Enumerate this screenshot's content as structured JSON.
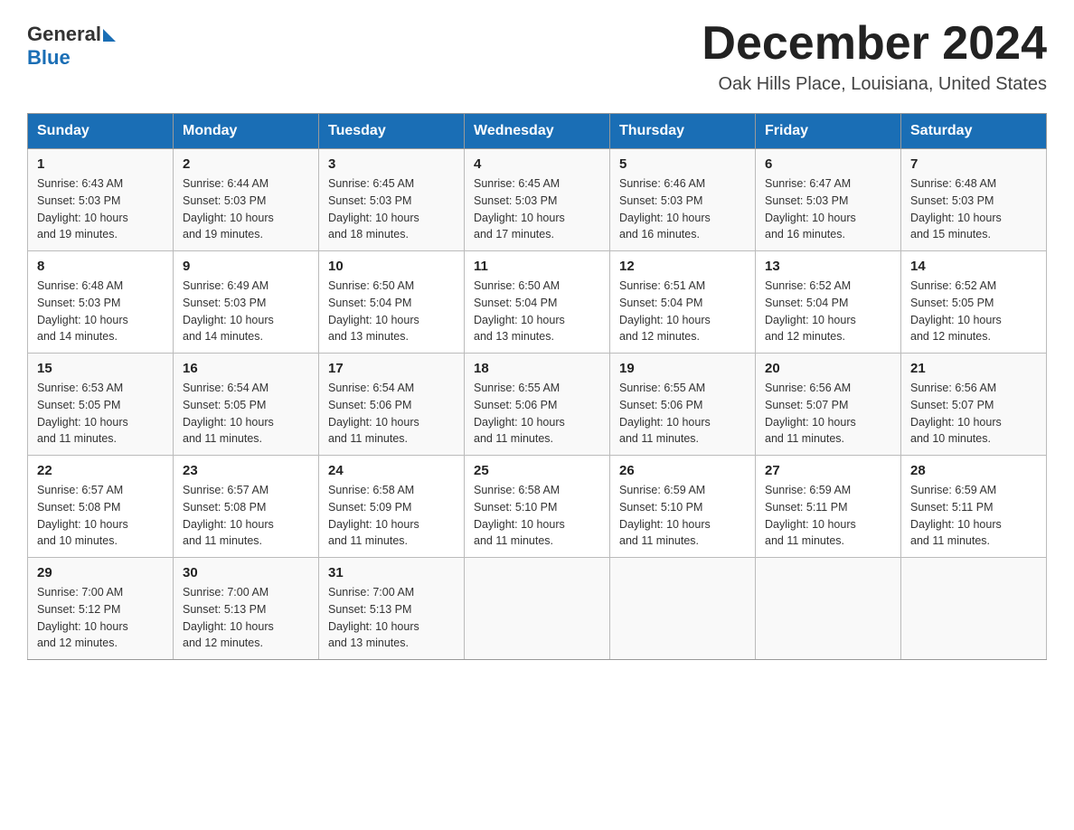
{
  "header": {
    "logo_general": "General",
    "logo_blue": "Blue",
    "month_title": "December 2024",
    "location": "Oak Hills Place, Louisiana, United States"
  },
  "days_of_week": [
    "Sunday",
    "Monday",
    "Tuesday",
    "Wednesday",
    "Thursday",
    "Friday",
    "Saturday"
  ],
  "weeks": [
    [
      {
        "day": "1",
        "sunrise": "6:43 AM",
        "sunset": "5:03 PM",
        "daylight": "10 hours and 19 minutes."
      },
      {
        "day": "2",
        "sunrise": "6:44 AM",
        "sunset": "5:03 PM",
        "daylight": "10 hours and 19 minutes."
      },
      {
        "day": "3",
        "sunrise": "6:45 AM",
        "sunset": "5:03 PM",
        "daylight": "10 hours and 18 minutes."
      },
      {
        "day": "4",
        "sunrise": "6:45 AM",
        "sunset": "5:03 PM",
        "daylight": "10 hours and 17 minutes."
      },
      {
        "day": "5",
        "sunrise": "6:46 AM",
        "sunset": "5:03 PM",
        "daylight": "10 hours and 16 minutes."
      },
      {
        "day": "6",
        "sunrise": "6:47 AM",
        "sunset": "5:03 PM",
        "daylight": "10 hours and 16 minutes."
      },
      {
        "day": "7",
        "sunrise": "6:48 AM",
        "sunset": "5:03 PM",
        "daylight": "10 hours and 15 minutes."
      }
    ],
    [
      {
        "day": "8",
        "sunrise": "6:48 AM",
        "sunset": "5:03 PM",
        "daylight": "10 hours and 14 minutes."
      },
      {
        "day": "9",
        "sunrise": "6:49 AM",
        "sunset": "5:03 PM",
        "daylight": "10 hours and 14 minutes."
      },
      {
        "day": "10",
        "sunrise": "6:50 AM",
        "sunset": "5:04 PM",
        "daylight": "10 hours and 13 minutes."
      },
      {
        "day": "11",
        "sunrise": "6:50 AM",
        "sunset": "5:04 PM",
        "daylight": "10 hours and 13 minutes."
      },
      {
        "day": "12",
        "sunrise": "6:51 AM",
        "sunset": "5:04 PM",
        "daylight": "10 hours and 12 minutes."
      },
      {
        "day": "13",
        "sunrise": "6:52 AM",
        "sunset": "5:04 PM",
        "daylight": "10 hours and 12 minutes."
      },
      {
        "day": "14",
        "sunrise": "6:52 AM",
        "sunset": "5:05 PM",
        "daylight": "10 hours and 12 minutes."
      }
    ],
    [
      {
        "day": "15",
        "sunrise": "6:53 AM",
        "sunset": "5:05 PM",
        "daylight": "10 hours and 11 minutes."
      },
      {
        "day": "16",
        "sunrise": "6:54 AM",
        "sunset": "5:05 PM",
        "daylight": "10 hours and 11 minutes."
      },
      {
        "day": "17",
        "sunrise": "6:54 AM",
        "sunset": "5:06 PM",
        "daylight": "10 hours and 11 minutes."
      },
      {
        "day": "18",
        "sunrise": "6:55 AM",
        "sunset": "5:06 PM",
        "daylight": "10 hours and 11 minutes."
      },
      {
        "day": "19",
        "sunrise": "6:55 AM",
        "sunset": "5:06 PM",
        "daylight": "10 hours and 11 minutes."
      },
      {
        "day": "20",
        "sunrise": "6:56 AM",
        "sunset": "5:07 PM",
        "daylight": "10 hours and 11 minutes."
      },
      {
        "day": "21",
        "sunrise": "6:56 AM",
        "sunset": "5:07 PM",
        "daylight": "10 hours and 10 minutes."
      }
    ],
    [
      {
        "day": "22",
        "sunrise": "6:57 AM",
        "sunset": "5:08 PM",
        "daylight": "10 hours and 10 minutes."
      },
      {
        "day": "23",
        "sunrise": "6:57 AM",
        "sunset": "5:08 PM",
        "daylight": "10 hours and 11 minutes."
      },
      {
        "day": "24",
        "sunrise": "6:58 AM",
        "sunset": "5:09 PM",
        "daylight": "10 hours and 11 minutes."
      },
      {
        "day": "25",
        "sunrise": "6:58 AM",
        "sunset": "5:10 PM",
        "daylight": "10 hours and 11 minutes."
      },
      {
        "day": "26",
        "sunrise": "6:59 AM",
        "sunset": "5:10 PM",
        "daylight": "10 hours and 11 minutes."
      },
      {
        "day": "27",
        "sunrise": "6:59 AM",
        "sunset": "5:11 PM",
        "daylight": "10 hours and 11 minutes."
      },
      {
        "day": "28",
        "sunrise": "6:59 AM",
        "sunset": "5:11 PM",
        "daylight": "10 hours and 11 minutes."
      }
    ],
    [
      {
        "day": "29",
        "sunrise": "7:00 AM",
        "sunset": "5:12 PM",
        "daylight": "10 hours and 12 minutes."
      },
      {
        "day": "30",
        "sunrise": "7:00 AM",
        "sunset": "5:13 PM",
        "daylight": "10 hours and 12 minutes."
      },
      {
        "day": "31",
        "sunrise": "7:00 AM",
        "sunset": "5:13 PM",
        "daylight": "10 hours and 13 minutes."
      },
      null,
      null,
      null,
      null
    ]
  ],
  "labels": {
    "sunrise": "Sunrise:",
    "sunset": "Sunset:",
    "daylight": "Daylight:"
  }
}
